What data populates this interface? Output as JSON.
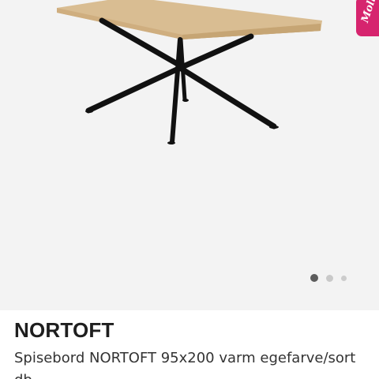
{
  "product": {
    "title": "NORTOFT",
    "description": "Spisebord NORTOFT 95x200 varm egefarve/sort",
    "description_next_line": "db"
  },
  "gallery": {
    "image_icon": "dining-table-image",
    "active_index": 1,
    "total_images": 3
  },
  "badge": {
    "text": "Molly"
  },
  "colors": {
    "background": "#f3f3f3",
    "tabletop": "#d9bd92",
    "legs": "#111111",
    "badge": "#d6246e",
    "dot_active": "#5c5c5c",
    "dot_inactive": "#cccccc"
  }
}
